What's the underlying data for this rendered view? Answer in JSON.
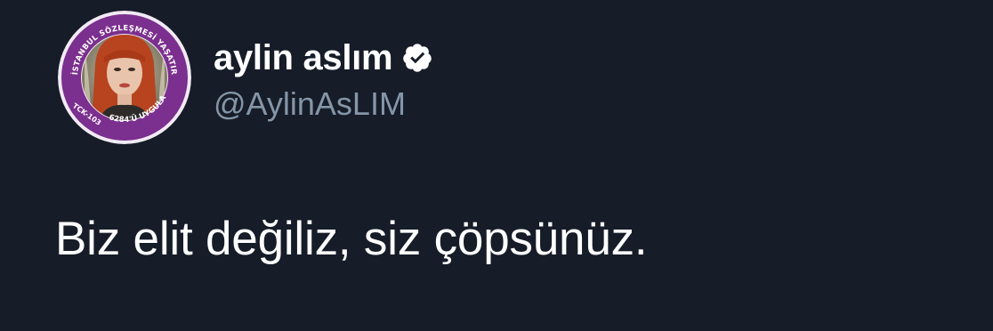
{
  "tweet": {
    "author": {
      "display_name": "aylin aslım",
      "handle": "@AylinAsLIM",
      "verified": true,
      "verified_icon": "verified-badge-icon"
    },
    "avatar": {
      "ring_text_top": "İSTANBUL SÖZLEŞMESİ YAŞATIR",
      "ring_text_left": "TCK-103",
      "ring_text_bottom": "6284'Ü UYGULA",
      "ring_color": "#7b2f8e"
    },
    "text": "Biz elit değiliz, siz çöpsünüz."
  },
  "colors": {
    "background": "#161c28",
    "name": "#ffffff",
    "handle": "#8596a8",
    "body_text": "#ffffff"
  }
}
